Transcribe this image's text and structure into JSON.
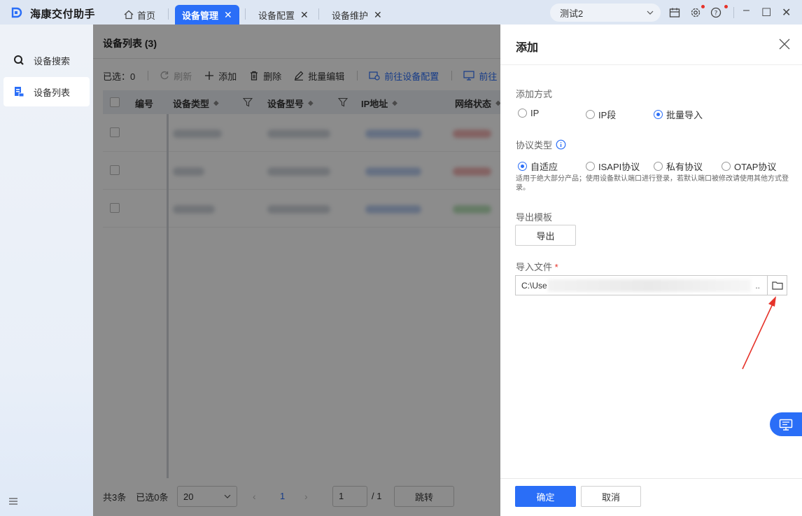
{
  "app": {
    "title": "海康交付助手"
  },
  "tabs": [
    {
      "label": "首页",
      "active": false
    },
    {
      "label": "设备管理",
      "active": true
    },
    {
      "label": "设备配置",
      "active": false
    },
    {
      "label": "设备维护",
      "active": false
    }
  ],
  "titlebar": {
    "profile_value": "测试2"
  },
  "sidebar": {
    "items": [
      {
        "label": "设备搜索",
        "icon": "search-icon"
      },
      {
        "label": "设备列表",
        "icon": "list-icon",
        "active": true
      }
    ]
  },
  "main": {
    "title": "设备列表 (3)",
    "toolbar": {
      "selected": "已选：0",
      "refresh": "刷新",
      "add": "添加",
      "delete": "删除",
      "batch_edit": "批量编辑",
      "goto_config": "前往设备配置",
      "goto_more": "前往"
    },
    "columns": [
      "编号",
      "设备类型",
      "设备型号",
      "IP地址",
      "网络状态"
    ],
    "row_count": 3,
    "footer": {
      "total": "共3条",
      "selected": "已选0条",
      "page_size": "20",
      "current_page": "1",
      "page_input": "1",
      "page_total": "/ 1",
      "jump": "跳转"
    }
  },
  "panel": {
    "title": "添加",
    "add_method": {
      "label": "添加方式",
      "options": [
        "IP",
        "IP段",
        "批量导入"
      ],
      "selected": "批量导入"
    },
    "protocol": {
      "label": "协议类型",
      "options": [
        "自适应",
        "ISAPI协议",
        "私有协议",
        "OTAP协议"
      ],
      "selected": "自适应",
      "hint": "适用于绝大部分产品；使用设备默认端口进行登录，若默认端口被修改请使用其他方式登录。"
    },
    "export_template": {
      "label": "导出模板",
      "button": "导出"
    },
    "import_file": {
      "label": "导入文件",
      "required_mark": "*",
      "value": "C:\\Use",
      "ellipsis": ".."
    },
    "confirm": "确定",
    "cancel": "取消"
  },
  "colors": {
    "accent": "#2a6ef7",
    "required": "#e6332a",
    "annotation": "#e6332a"
  }
}
